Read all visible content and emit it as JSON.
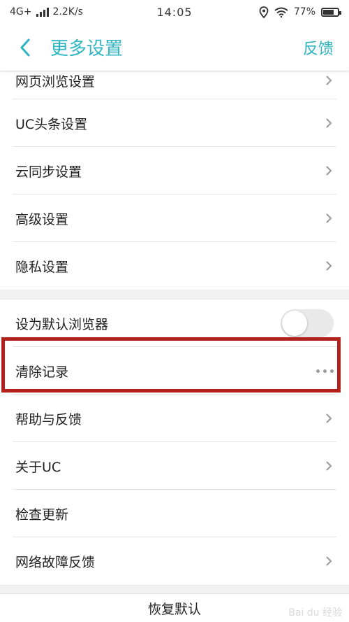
{
  "status_bar": {
    "network": "4G+",
    "speed": "2.2K/s",
    "time": "14:05",
    "battery_percent_label": "77%",
    "battery_level": 0.77
  },
  "header": {
    "title": "更多设置",
    "feedback_label": "反馈"
  },
  "settings": {
    "group1": [
      {
        "label": "网页浏览设置"
      },
      {
        "label": "UC头条设置"
      },
      {
        "label": "云同步设置"
      },
      {
        "label": "高级设置"
      },
      {
        "label": "隐私设置"
      }
    ],
    "default_browser": {
      "label": "设为默认浏览器",
      "enabled": false
    },
    "clear_records": {
      "label": "清除记录"
    },
    "group2": [
      {
        "label": "帮助与反馈"
      },
      {
        "label": "关于UC"
      },
      {
        "label": "检查更新"
      },
      {
        "label": "网络故障反馈"
      }
    ]
  },
  "footer": {
    "restore_label": "恢复默认"
  },
  "watermark": "Bai du 经验"
}
